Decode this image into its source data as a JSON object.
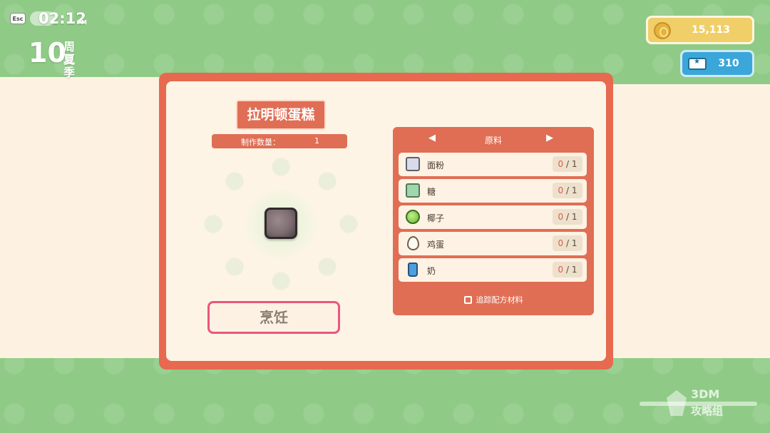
{
  "hud": {
    "esc_label": "Esc",
    "time": "02:12",
    "ampm": "PM",
    "day": "10",
    "weekday": "周二",
    "season": "夏季"
  },
  "currency": {
    "gold": "15,113",
    "tickets": "310"
  },
  "recipe": {
    "name": "拉明顿蛋糕",
    "quantity_label": "制作数量：",
    "quantity_value": "1",
    "cook_button": "烹饪"
  },
  "ingredients": {
    "header": "原料",
    "prev_arrow": "◀",
    "next_arrow": "▶",
    "items": [
      {
        "name": "面粉",
        "have": "0",
        "need": " / 1",
        "icon": "flour-icon"
      },
      {
        "name": "糖",
        "have": "0",
        "need": " / 1",
        "icon": "sugar-icon"
      },
      {
        "name": "椰子",
        "have": "0",
        "need": " / 1",
        "icon": "coconut-icon"
      },
      {
        "name": "鸡蛋",
        "have": "0",
        "need": " / 1",
        "icon": "egg-icon"
      },
      {
        "name": "奶",
        "have": "0",
        "need": " / 1",
        "icon": "milk-icon"
      }
    ],
    "track_label": "追踪配方材料"
  },
  "watermark": {
    "line1": "3DM",
    "line2": "攻略组"
  },
  "colors": {
    "background_green": "#8fcb86",
    "panel_orange": "#e7694f",
    "cream": "#fdf4e6",
    "cook_border": "#e9577b"
  }
}
